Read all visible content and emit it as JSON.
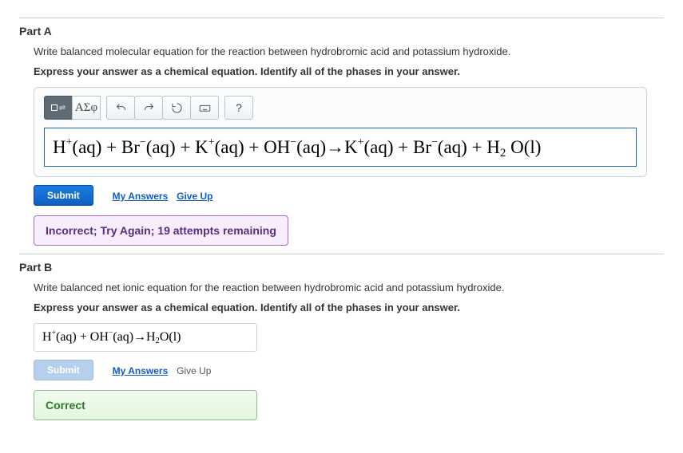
{
  "partA": {
    "title": "Part A",
    "prompt": "Write balanced molecular equation for the reaction between hydrobromic acid and potassium hydroxide.",
    "instruction": "Express your answer as a chemical equation. Identify all of the phases in your answer.",
    "toolbar": {
      "greek_label": "ΑΣφ",
      "help_label": "?"
    },
    "equation_html": "H<span class='sup'>+</span>(aq) + Br<span class='sup'>−</span>(aq) + K<span class='sup'>+</span>(aq) + OH<span class='sup'>−</span>(aq)→K<span class='sup'>+</span>(aq) + Br<span class='sup'>−</span>(aq) + H<span class='sub'>2</span> O(l)",
    "actions": {
      "submit": "Submit",
      "my_answers": "My Answers",
      "give_up": "Give Up"
    },
    "feedback": "Incorrect; Try Again; 19 attempts remaining"
  },
  "partB": {
    "title": "Part B",
    "prompt": "Write balanced net ionic equation for the reaction between hydrobromic acid and potassium hydroxide.",
    "instruction": "Express your answer as a chemical equation. Identify all of the phases in your answer.",
    "equation_html": "H<span class='sup'>+</span>(aq) + OH<span class='sup'>−</span>(aq)→H<span class='sub'>2</span>O(l)",
    "actions": {
      "submit": "Submit",
      "my_answers": "My Answers",
      "give_up": "Give Up"
    },
    "feedback": "Correct"
  }
}
